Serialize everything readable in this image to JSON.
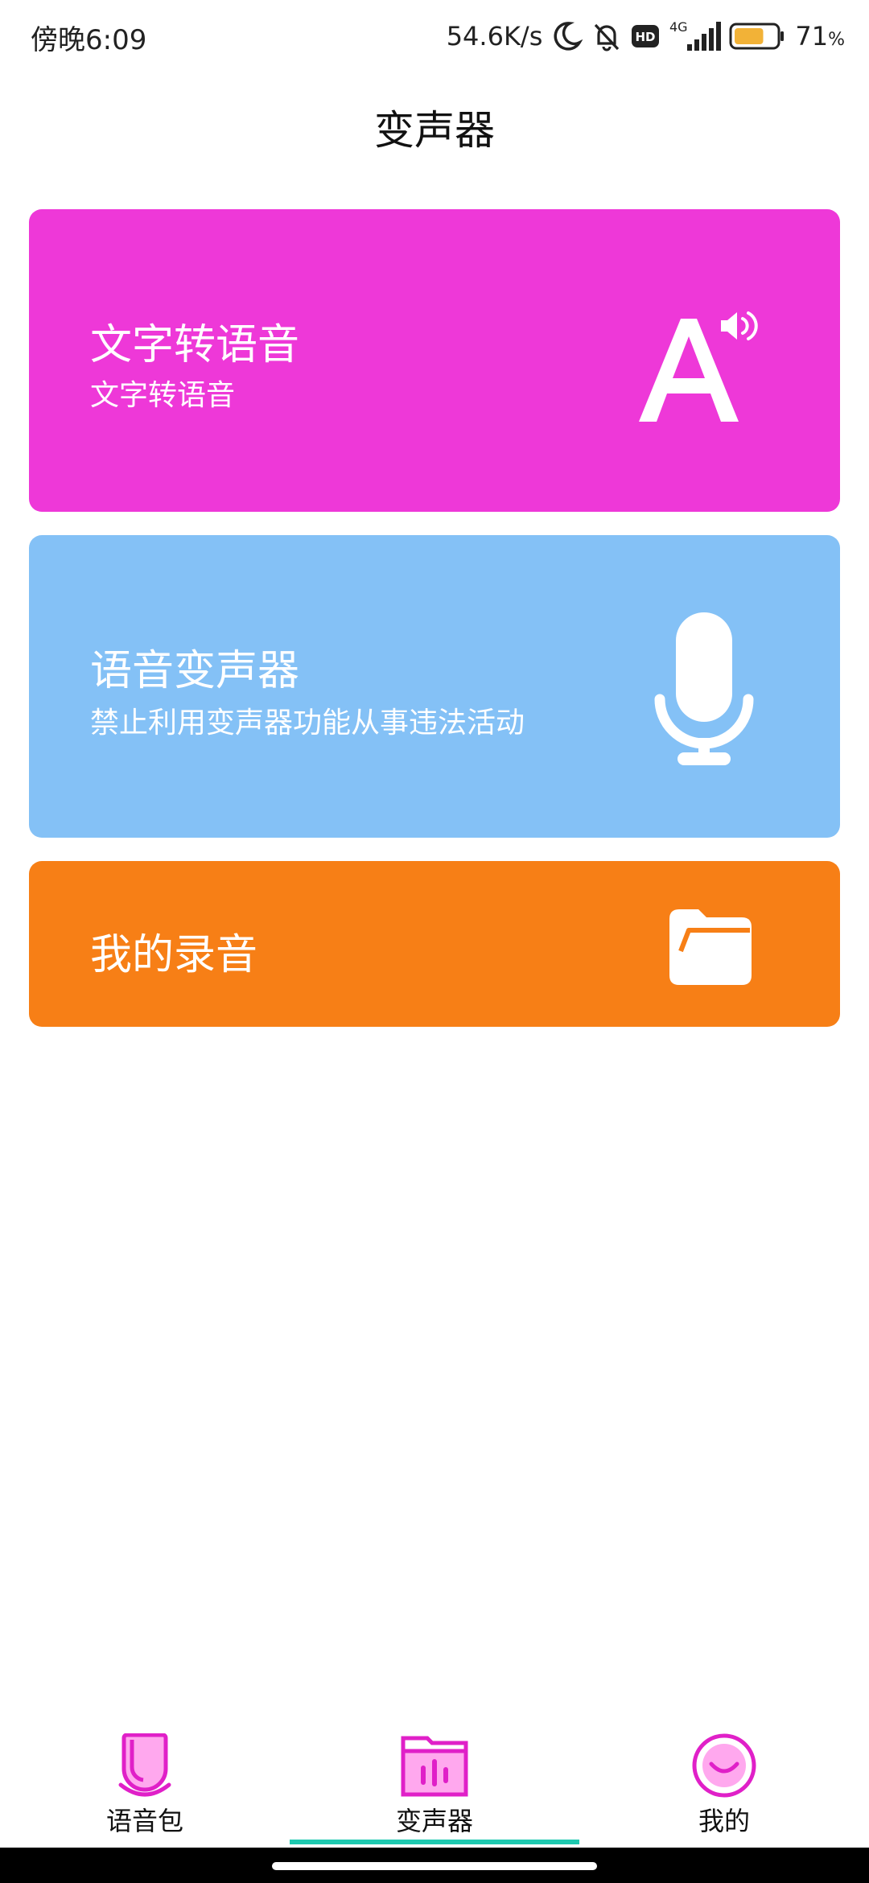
{
  "status_bar": {
    "time": "傍晚6:09",
    "net_speed": "54.6K/s",
    "network_type": "4G",
    "hd_label": "HD",
    "battery_percent": "71",
    "battery_unit": "%",
    "battery_level": 0.71,
    "icons": [
      "moon-icon",
      "bell-muted-icon",
      "hd-icon",
      "signal-icon",
      "battery-icon"
    ]
  },
  "header": {
    "title": "变声器"
  },
  "cards": {
    "tts": {
      "title": "文字转语音",
      "subtitle": "文字转语音",
      "color": "#ee38d8",
      "icon": "text-speaker-icon"
    },
    "voice_changer": {
      "title": "语音变声器",
      "subtitle": "禁止利用变声器功能从事违法活动",
      "color": "#84c1f6",
      "icon": "microphone-icon"
    },
    "recordings": {
      "title": "我的录音",
      "color": "#f77f16",
      "icon": "folder-icon"
    }
  },
  "bottom_nav": {
    "items": [
      {
        "label": "语音包",
        "icon": "voice-pack-icon",
        "active": false
      },
      {
        "label": "变声器",
        "icon": "voice-changer-icon",
        "active": true
      },
      {
        "label": "我的",
        "icon": "profile-smile-icon",
        "active": false
      }
    ],
    "accent": "#e020c8",
    "indicator_color": "#1ec9b0"
  }
}
